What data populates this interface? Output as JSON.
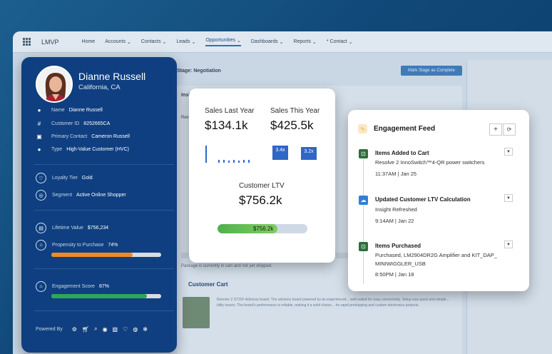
{
  "background_crm": {
    "app_name": "LMVP",
    "tabs": [
      "Home",
      "Accounts",
      "Contacts",
      "Leads",
      "Opportunities",
      "Dashboards",
      "Reports",
      "* Contact"
    ],
    "active_tab_index": 4,
    "stage_text": "Stage: Negotiation",
    "mark_stage_button": "Mark Stage as Complete",
    "insights_label": "Insi",
    "revenue_label": "Reve",
    "package_note": "Package is currently in cart and not yet shipped.",
    "customer_cart_title": "Customer Cart",
    "cart_item_text": "Resolve 2 ST32F Advisory board. The advisory board powered by an experienced... well-suited for easy connectivity. Setup was quick and simple... bility issues. The board's performance is reliable, making it a solid choice... for rapid prototyping and custom electronics projects."
  },
  "profile": {
    "name": "Dianne Russell",
    "location": "California, CA",
    "fields": [
      {
        "icon": "location-pin-icon",
        "label": "Name",
        "value": "Dianne Russell"
      },
      {
        "icon": "hash-icon",
        "label": "Customer ID",
        "value": "8252665CA"
      },
      {
        "icon": "id-card-icon",
        "label": "Primary Contact",
        "value": "Cameron Russell"
      },
      {
        "icon": "location-pin-icon",
        "label": "Type",
        "value": "High-Value Customer (HVC)"
      }
    ],
    "loyalty_label": "Loyalty Tier",
    "loyalty_value": "Gold",
    "segment_label": "Segment",
    "segment_value": "Active Online Shopper",
    "lifetime_label": "Lifetime Value",
    "lifetime_value": "$756,234",
    "propensity_label": "Propensity to Purchase",
    "propensity_value": "74%",
    "propensity_fraction": 0.74,
    "propensity_color": "#f08a24",
    "engagement_label": "Engagement Score",
    "engagement_value": "87%",
    "engagement_fraction": 0.87,
    "engagement_color": "#2fa65a",
    "powered_by_label": "Powered By"
  },
  "sales": {
    "last_year_label": "Sales Last Year",
    "last_year_value": "$134.1k",
    "this_year_label": "Sales This Year",
    "this_year_value": "$425.5k",
    "chip_a": "3.4x",
    "chip_b": "3.2x",
    "ltv_label": "Customer LTV",
    "ltv_value": "$756.2k",
    "ltv_bar_label": "$756.2k",
    "ltv_fraction": 0.67
  },
  "feed": {
    "title": "Engagement Feed",
    "add_label": "+",
    "refresh_label": "⟳",
    "items": [
      {
        "title": "Items Added to Cart",
        "desc": "Resolve 2 InnoSwitch™4-QR power switchers",
        "time": "11:37AM | Jan 25",
        "icon": "cart-icon",
        "color": "#2f6e3a"
      },
      {
        "title": "Updated Customer LTV Calculation",
        "desc": "Insight Refreshed",
        "time": "9:14AM | Jan 22",
        "icon": "cloud-icon",
        "color": "#2f7fd4"
      },
      {
        "title": "Items Purchased",
        "desc": "Purchased, LM2904DR2G Amplifier and KIT_DAP_ MINIWIGGLER_USB",
        "time": "8:50PM | Jan 18",
        "icon": "cart-icon",
        "color": "#2f6e3a"
      }
    ]
  }
}
